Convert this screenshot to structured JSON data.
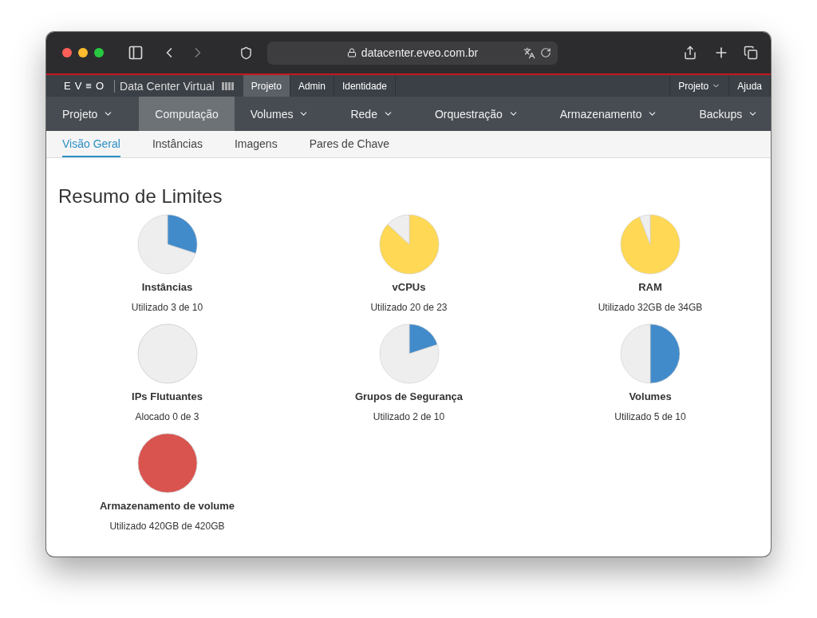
{
  "browser": {
    "url": "datacenter.eveo.com.br"
  },
  "brand": {
    "logo": "EV≡O",
    "product": "Data Center Virtual"
  },
  "top_nav": {
    "left": [
      {
        "label": "Projeto",
        "selected": true
      },
      {
        "label": "Admin",
        "selected": false
      },
      {
        "label": "Identidade",
        "selected": false
      }
    ],
    "right": [
      {
        "label": "Projeto",
        "has_menu": true
      },
      {
        "label": "Ajuda",
        "has_menu": false
      }
    ]
  },
  "main_nav": [
    {
      "label": "Projeto",
      "selected": false,
      "has_menu": true
    },
    {
      "label": "Computação",
      "selected": true,
      "has_menu": false
    },
    {
      "label": "Volumes",
      "selected": false,
      "has_menu": true
    },
    {
      "label": "Rede",
      "selected": false,
      "has_menu": true
    },
    {
      "label": "Orquestração",
      "selected": false,
      "has_menu": true
    },
    {
      "label": "Armazenamento",
      "selected": false,
      "has_menu": true
    },
    {
      "label": "Backups",
      "selected": false,
      "has_menu": true
    }
  ],
  "sub_nav": [
    {
      "label": "Visão Geral",
      "selected": true
    },
    {
      "label": "Instâncias",
      "selected": false
    },
    {
      "label": "Imagens",
      "selected": false
    },
    {
      "label": "Pares de Chave",
      "selected": false
    }
  ],
  "page_title": "Resumo de Limites",
  "limits": [
    {
      "name": "Instâncias",
      "usage": "Utilizado 3 de 10",
      "chart_data": {
        "type": "pie",
        "values": [
          30,
          70
        ]
      }
    },
    {
      "name": "vCPUs",
      "usage": "Utilizado 20 de 23",
      "chart_data": {
        "type": "pie",
        "values": [
          86.96,
          13.04
        ]
      }
    },
    {
      "name": "RAM",
      "usage": "Utilizado 32GB de 34GB",
      "chart_data": {
        "type": "pie",
        "values": [
          94.12,
          5.88
        ]
      }
    },
    {
      "name": "IPs Flutuantes",
      "usage": "Alocado 0 de 3",
      "chart_data": {
        "type": "pie",
        "values": [
          0,
          100
        ]
      }
    },
    {
      "name": "Grupos de Segurança",
      "usage": "Utilizado 2 de 10",
      "chart_data": {
        "type": "pie",
        "values": [
          20,
          80
        ]
      }
    },
    {
      "name": "Volumes",
      "usage": "Utilizado 5 de 10",
      "chart_data": {
        "type": "pie",
        "values": [
          50,
          50
        ]
      }
    },
    {
      "name": "Armazenamento de volume",
      "usage": "Utilizado 420GB de 420GB",
      "chart_data": {
        "type": "pie",
        "values": [
          100,
          0
        ]
      }
    }
  ]
}
